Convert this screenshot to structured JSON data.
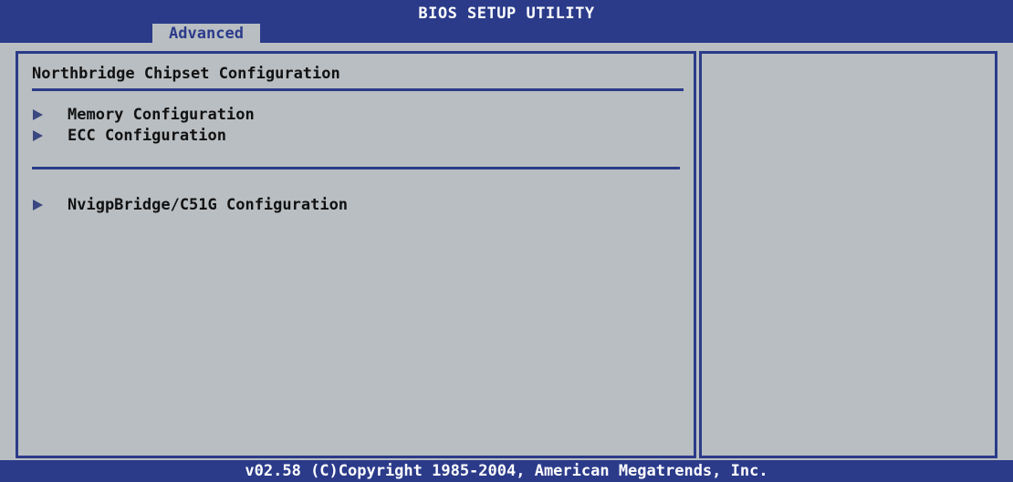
{
  "header": {
    "title": "BIOS SETUP UTILITY",
    "tabs": [
      {
        "label": "Advanced",
        "active": true
      }
    ]
  },
  "main": {
    "section_title": "Northbridge Chipset Configuration",
    "groups": [
      {
        "items": [
          {
            "label": "Memory Configuration"
          },
          {
            "label": "ECC Configuration"
          }
        ]
      },
      {
        "items": [
          {
            "label": "NvigpBridge/C51G Configuration"
          }
        ]
      }
    ]
  },
  "help_panel": {
    "text": ""
  },
  "footer": {
    "copyright": "v02.58 (C)Copyright 1985-2004, American Megatrends, Inc."
  },
  "colors": {
    "frame_blue": "#2b3b8a",
    "background_gray": "#b9bec2",
    "text": "#111111",
    "header_text": "#ffffff"
  }
}
